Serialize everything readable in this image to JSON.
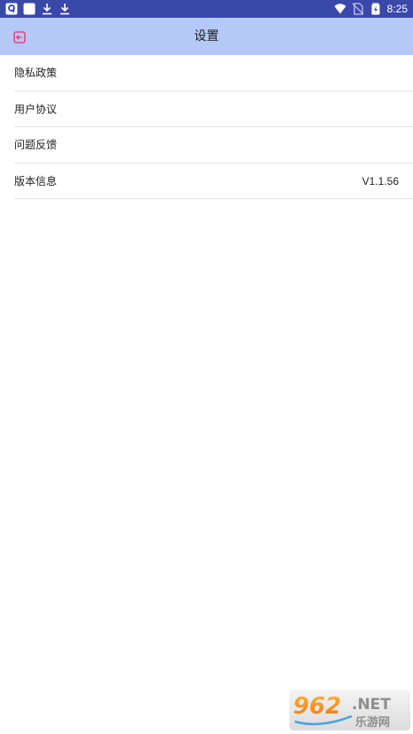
{
  "status_bar": {
    "time": "8:25",
    "left_icons": [
      "app-notification-icon",
      "square-notification-icon",
      "download-icon",
      "download-icon"
    ],
    "right_icons": [
      "wifi-icon",
      "no-sim-icon",
      "battery-icon"
    ]
  },
  "app_bar": {
    "title": "设置",
    "back_icon": "exit-icon",
    "background": "#b5c9f8",
    "icon_color": "#e8457a"
  },
  "settings": {
    "items": [
      {
        "label": "隐私政策",
        "value": ""
      },
      {
        "label": "用户协议",
        "value": ""
      },
      {
        "label": "问题反馈",
        "value": ""
      },
      {
        "label": "版本信息",
        "value": "V1.1.56"
      }
    ]
  },
  "watermark": {
    "brand": "962.NET",
    "subtitle": "乐游网"
  },
  "colors": {
    "status_bar": "#3a48a8",
    "divider": "#e6e6e6"
  }
}
